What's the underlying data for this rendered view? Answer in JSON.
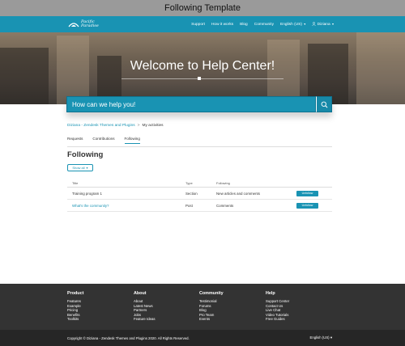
{
  "window": {
    "title": "Following Template"
  },
  "nav": {
    "logo_text_1": "Pacific",
    "logo_text_2": "Paradise",
    "links": [
      "Support",
      "How it works",
      "Blog",
      "Community"
    ],
    "language": "English (US)",
    "user": "Diziana"
  },
  "hero": {
    "title": "Welcome to Help Center!"
  },
  "search": {
    "placeholder": "How can we help you!"
  },
  "breadcrumb": {
    "parent": "Diziana - Zendesk Themes and Plugins",
    "separator": ">",
    "current": "My activities"
  },
  "tabs": [
    {
      "label": "Requests",
      "active": false
    },
    {
      "label": "Contributions",
      "active": false
    },
    {
      "label": "Following",
      "active": true
    }
  ],
  "page": {
    "heading": "Following",
    "show_all": "Show all"
  },
  "table": {
    "headers": [
      "Title",
      "Type",
      "Following",
      ""
    ],
    "rows": [
      {
        "title": "Training program 1",
        "type": "Section",
        "following": "New articles and comments",
        "action": "Unfollow",
        "title_is_link": false
      },
      {
        "title": "What's the community?",
        "type": "Post",
        "following": "Comments",
        "action": "Unfollow",
        "title_is_link": true
      }
    ]
  },
  "footer": {
    "columns": [
      {
        "heading": "Product",
        "items": [
          "Features",
          "Example",
          "Pricing",
          "Benefits",
          "Toolkits"
        ]
      },
      {
        "heading": "About",
        "items": [
          "About",
          "Latest News",
          "Partners",
          "Jobs",
          "Feature Ideas"
        ]
      },
      {
        "heading": "Community",
        "items": [
          "Testimonial",
          "Forums",
          "Blog",
          "Pro Team",
          "Events"
        ]
      },
      {
        "heading": "Help",
        "items": [
          "Support Center",
          "Contact Us",
          "Live Chat",
          "Video Tutorials",
          "Free Guides"
        ]
      }
    ],
    "copyright": "Copyright © Diziana - Zendesk Themes and Plugins 2020. All Rights Reserved.",
    "language": "English (US)"
  },
  "colors": {
    "primary": "#1993b3",
    "footer": "#333333",
    "footer_bottom": "#262626",
    "title_bar": "#9a9a9a"
  }
}
